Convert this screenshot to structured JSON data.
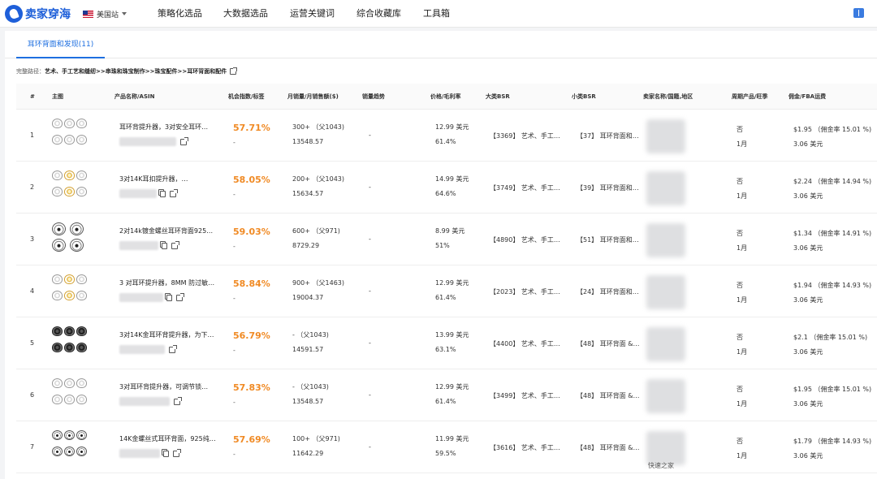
{
  "brand": {
    "name": "卖家穿海"
  },
  "site": {
    "label": "美国站"
  },
  "nav": [
    "策略化选品",
    "大数据选品",
    "运营关键词",
    "综合收藏库",
    "工具箱"
  ],
  "tab": {
    "label": "耳环背面和发现(11)"
  },
  "path": {
    "prefix": "完整路径：",
    "value": "艺术、手工艺和缝纫>>串珠和珠宝制作>>珠宝配件>>耳环背面和配件"
  },
  "table": {
    "headers": [
      "#",
      "主图",
      "产品名称/ASIN",
      "机会指数/标签",
      "月销量/月销售额($)",
      "销量趋势",
      "价格/毛利率",
      "大类BSR",
      "小类BSR",
      "卖家名称/国籍,地区",
      "周期产品/旺季",
      "佣金/FBA运费"
    ],
    "rows": [
      {
        "idx": "1",
        "title": "耳环背提升器，3对安全耳环…",
        "score": "57.71%",
        "tag": "-",
        "sales": "300+ （父1043)",
        "revenue": "13548.57",
        "trend": "-",
        "price": "12.99 美元",
        "margin": "61.4%",
        "bsr_big": "【3369】 艺术、手工…",
        "bsr_small": "【37】 耳环背面和…",
        "seller": "",
        "cycle": "否",
        "season": "1月",
        "commission": "$1.95 （佣金率 15.01 %)",
        "fba": "3.06 美元",
        "thumb": "silver"
      },
      {
        "idx": "2",
        "title": "3对14K耳扣提升器，…",
        "score": "58.05%",
        "tag": "-",
        "sales": "200+ （父1043)",
        "revenue": "15634.57",
        "trend": "-",
        "price": "14.99 美元",
        "margin": "64.6%",
        "bsr_big": "【3749】 艺术、手工…",
        "bsr_small": "【39】 耳环背面和…",
        "seller": "",
        "cycle": "否",
        "season": "1月",
        "commission": "$2.24 （佣金率 14.94 %)",
        "fba": "3.06 美元",
        "thumb": "mixed"
      },
      {
        "idx": "3",
        "title": "2对14k镀金螺丝耳环背面925…",
        "score": "59.03%",
        "tag": "-",
        "sales": "600+ （父971)",
        "revenue": "8729.29",
        "trend": "-",
        "price": "8.99 美元",
        "margin": "51%",
        "bsr_big": "【4890】 艺术、手工…",
        "bsr_small": "【51】 耳环背面和…",
        "seller": "",
        "cycle": "否",
        "season": "1月",
        "commission": "$1.34 （佣金率 14.91 %)",
        "fba": "3.06 美元",
        "thumb": "disc"
      },
      {
        "idx": "4",
        "title": "3 对耳环提升器，8MM 防过敏…",
        "score": "58.84%",
        "tag": "-",
        "sales": "900+ （父1463)",
        "revenue": "19004.37",
        "trend": "-",
        "price": "12.99 美元",
        "margin": "61.4%",
        "bsr_big": "【2023】 艺术、手工…",
        "bsr_small": "【24】 耳环背面和…",
        "seller": "",
        "cycle": "否",
        "season": "1月",
        "commission": "$1.94 （佣金率 14.93 %)",
        "fba": "3.06 美元",
        "thumb": "mixed"
      },
      {
        "idx": "5",
        "title": "3对14K金耳环背提升器，为下…",
        "score": "56.79%",
        "tag": "-",
        "sales": "- （父1043)",
        "revenue": "14591.57",
        "trend": "-",
        "price": "13.99 美元",
        "margin": "63.1%",
        "bsr_big": "【4400】 艺术、手工…",
        "bsr_small": "【48】 耳环背面 &…",
        "seller": "",
        "cycle": "否",
        "season": "1月",
        "commission": "$2.1 （佣金率 15.01 %)",
        "fba": "3.06 美元",
        "thumb": "black"
      },
      {
        "idx": "6",
        "title": "3对耳环背提升器，可调节锁…",
        "score": "57.83%",
        "tag": "-",
        "sales": "- （父1043)",
        "revenue": "13548.57",
        "trend": "-",
        "price": "12.99 美元",
        "margin": "61.4%",
        "bsr_big": "【3499】 艺术、手工…",
        "bsr_small": "【48】 耳环背面 &…",
        "seller": "",
        "cycle": "否",
        "season": "1月",
        "commission": "$1.95 （佣金率 15.01 %)",
        "fba": "3.06 美元",
        "thumb": "silver"
      },
      {
        "idx": "7",
        "title": "14K金螺丝式耳环背面，925纯…",
        "score": "57.69%",
        "tag": "-",
        "sales": "100+ （父971)",
        "revenue": "11642.29",
        "trend": "-",
        "price": "11.99 美元",
        "margin": "59.5%",
        "bsr_big": "【3616】 艺术、手工…",
        "bsr_small": "【48】 耳环背面 &…",
        "seller": "快速之家",
        "cycle": "否",
        "season": "1月",
        "commission": "$1.79 （佣金率 14.93 %)",
        "fba": "3.06 美元",
        "thumb": "disc"
      }
    ]
  },
  "colors": {
    "accent": "#1e6fe0",
    "score": "#f08a24"
  }
}
